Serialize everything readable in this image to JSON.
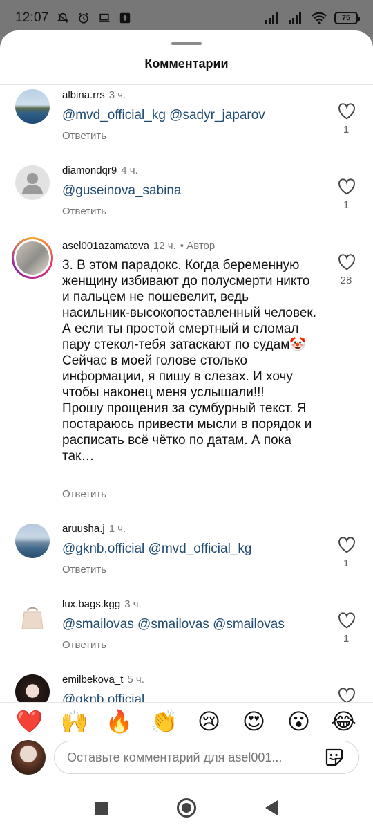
{
  "status": {
    "time": "12:07",
    "battery": "75"
  },
  "sheet": {
    "title": "Комментарии"
  },
  "comments": [
    {
      "username": "albina.rrs",
      "time": "3 ч.",
      "text": "@mvd_official_kg @sadyr_japarov",
      "reply": "Ответить",
      "likes": "1"
    },
    {
      "username": "diamondqr9",
      "time": "4 ч.",
      "text": "@guseinova_sabina",
      "reply": "Ответить",
      "likes": "1"
    },
    {
      "username": "asel001azamatova",
      "time": "12 ч.",
      "author": "• Автор",
      "text": "3. В этом парадокс. Когда беременную женщину избивают до полусмерти никто и пальцем не пошевелит, ведь насильник-высокопоставленный человек.\nА если ты простой смертный и сломал пару стекол-тебя затаскают по судам🤡\nСейчас в моей голове столько информации, я пишу в слезах. И хочу чтобы наконец меня услышали!!!\nПрошу прощения за сумбурный текст. Я постараюсь привести мысли в порядок и расписать всё чётко по датам. А пока так…",
      "reply": "Ответить",
      "likes": "28"
    },
    {
      "username": "aruusha.j",
      "time": "1 ч.",
      "text": "@gknb.official @mvd_official_kg",
      "reply": "Ответить",
      "likes": "1"
    },
    {
      "username": "lux.bags.kgg",
      "time": "3 ч.",
      "text": "@smailovas @smailovas @smailovas",
      "reply": "Ответить",
      "likes": "1"
    },
    {
      "username": "emilbekova_t",
      "time": "5 ч.",
      "text": "@gknb.official",
      "reply": "",
      "likes": ""
    }
  ],
  "emoji_bar": [
    "❤️",
    "🙌",
    "🔥",
    "👏",
    "😢",
    "😍",
    "😮",
    "😂"
  ],
  "input": {
    "placeholder": "Оставьте комментарий для asel001..."
  }
}
